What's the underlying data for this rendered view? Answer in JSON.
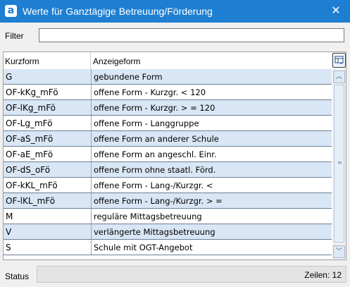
{
  "window": {
    "title": "Werte für Ganztägige Betreuung/Förderung",
    "app_icon_letter": "a",
    "app_icon": "app-logo-icon",
    "close_icon": "close-icon",
    "accent": "#1e7fd2"
  },
  "filter": {
    "label": "Filter",
    "value": ""
  },
  "grid": {
    "columns": [
      "Kurzform",
      "Anzeigeform"
    ],
    "column_selector_icon": "column-chooser-icon",
    "alt_row_color": "#d9e6f5",
    "rows": [
      {
        "kurz": "G",
        "anzeige": "gebundene Form"
      },
      {
        "kurz": "OF-kKg_mFö",
        "anzeige": "offene Form - Kurzgr. < 120"
      },
      {
        "kurz": "OF-lKg_mFö",
        "anzeige": "offene Form - Kurzgr. > = 120"
      },
      {
        "kurz": "OF-Lg_mFö",
        "anzeige": "offene Form - Langgruppe"
      },
      {
        "kurz": "OF-aS_mFö",
        "anzeige": "offene Form an anderer Schule"
      },
      {
        "kurz": "OF-aE_mFö",
        "anzeige": "offene Form an angeschl. Einr."
      },
      {
        "kurz": "OF-dS_oFö",
        "anzeige": "offene Form ohne staatl. Förd."
      },
      {
        "kurz": "OF-kKL_mFö",
        "anzeige": "offene Form - Lang-/Kurzgr. <"
      },
      {
        "kurz": "OF-lKL_mFö",
        "anzeige": "offene Form - Lang-/Kurzgr. > ="
      },
      {
        "kurz": "M",
        "anzeige": "reguläre Mittagsbetreuung"
      },
      {
        "kurz": "V",
        "anzeige": "verlängerte Mittagsbetreuung"
      },
      {
        "kurz": "S",
        "anzeige": "Schule mit OGT-Angebot"
      }
    ]
  },
  "scrollbar": {
    "up_icon": "scroll-up-icon",
    "down_icon": "scroll-down-icon"
  },
  "status": {
    "label": "Status",
    "count": "Zeilen: 12"
  }
}
